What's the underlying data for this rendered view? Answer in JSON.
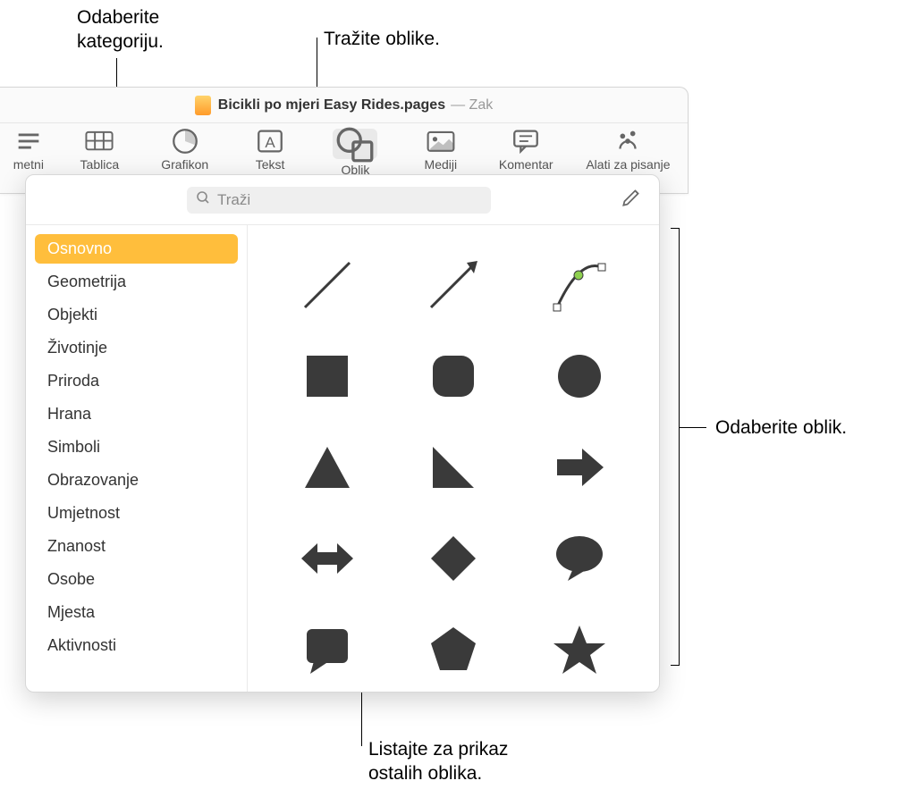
{
  "callouts": {
    "select_category": "Odaberite\nkategoriju.",
    "search_shapes": "Tražite oblike.",
    "select_shape": "Odaberite oblik.",
    "scroll_more": "Listajte za prikaz\nostalih oblika."
  },
  "titlebar": {
    "doc_name": "Bicikli po mjeri Easy Rides.pages",
    "status": "— Zak"
  },
  "toolbar": {
    "items": [
      {
        "id": "umetni",
        "label": "metni"
      },
      {
        "id": "tablica",
        "label": "Tablica"
      },
      {
        "id": "grafikon",
        "label": "Grafikon"
      },
      {
        "id": "tekst",
        "label": "Tekst"
      },
      {
        "id": "oblik",
        "label": "Oblik",
        "active": true
      },
      {
        "id": "mediji",
        "label": "Mediji"
      },
      {
        "id": "komentar",
        "label": "Komentar"
      },
      {
        "id": "alati",
        "label": "Alati za pisanje"
      }
    ]
  },
  "search": {
    "placeholder": "Traži"
  },
  "sidebar": {
    "items": [
      {
        "label": "Osnovno",
        "selected": true
      },
      {
        "label": "Geometrija"
      },
      {
        "label": "Objekti"
      },
      {
        "label": "Životinje"
      },
      {
        "label": "Priroda"
      },
      {
        "label": "Hrana"
      },
      {
        "label": "Simboli"
      },
      {
        "label": "Obrazovanje"
      },
      {
        "label": "Umjetnost"
      },
      {
        "label": "Znanost"
      },
      {
        "label": "Osobe"
      },
      {
        "label": "Mjesta"
      },
      {
        "label": "Aktivnosti"
      }
    ]
  },
  "shapes": [
    "line",
    "arrow-line",
    "curve-editable",
    "square",
    "rounded-square",
    "circle",
    "triangle",
    "right-triangle",
    "arrow-right",
    "double-arrow",
    "diamond",
    "speech-bubble",
    "callout-bubble",
    "pentagon",
    "star"
  ]
}
